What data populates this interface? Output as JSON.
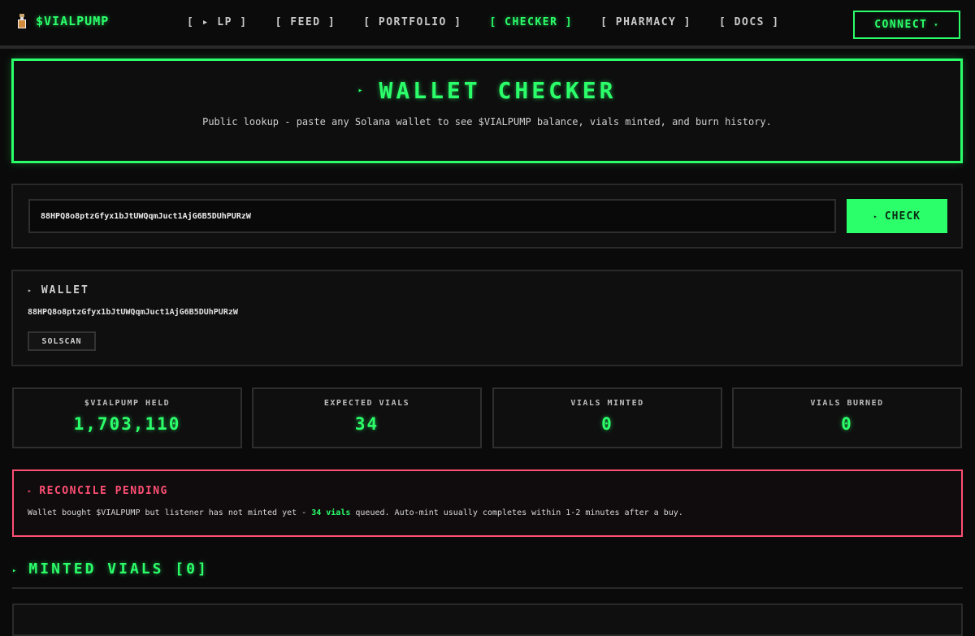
{
  "nav": {
    "brand": "$VIALPUMP",
    "links": [
      {
        "label": "[ ▸ LP ]"
      },
      {
        "label": "[ FEED ]"
      },
      {
        "label": "[ PORTFOLIO ]"
      },
      {
        "label": "[ CHECKER ]"
      },
      {
        "label": "[ PHARMACY ]"
      },
      {
        "label": "[ DOCS ]"
      }
    ],
    "active": "CHECKER",
    "connect_label": "CONNECT",
    "connect_caret": "▾"
  },
  "hero": {
    "arrow": "▸",
    "title": "WALLET CHECKER",
    "subtitle": "Public lookup - paste any Solana wallet to see $VIALPUMP balance, vials minted, and burn history."
  },
  "checker": {
    "input_value": "88HPQ8o8ptzGfyx1bJtUWQqmJuct1AjG6B5DUhPURzW",
    "button_arrow": "▸",
    "button_label": "CHECK"
  },
  "wallet": {
    "arrow": "▸",
    "heading": "WALLET",
    "address": "88HPQ8o8ptzGfyx1bJtUWQqmJuct1AjG6B5DUhPURzW",
    "solscan_label": "SOLSCAN"
  },
  "stats": [
    {
      "label": "$VIALPUMP HELD",
      "value": "1,703,110"
    },
    {
      "label": "EXPECTED VIALS",
      "value": "34"
    },
    {
      "label": "VIALS MINTED",
      "value": "0"
    },
    {
      "label": "VIALS BURNED",
      "value": "0"
    }
  ],
  "reconcile": {
    "arrow": "▸",
    "heading": "RECONCILE PENDING",
    "text_before": "Wallet bought $VIALPUMP but listener has not minted yet - ",
    "highlight": "34 vials",
    "text_after": " queued. Auto-mint usually completes within 1-2 minutes after a buy."
  },
  "minted": {
    "arrow": "▸",
    "heading": "MINTED VIALS [0]"
  },
  "colors": {
    "accent": "#2bff6a",
    "alert": "#ff4f74",
    "background": "#0a0a0a"
  }
}
